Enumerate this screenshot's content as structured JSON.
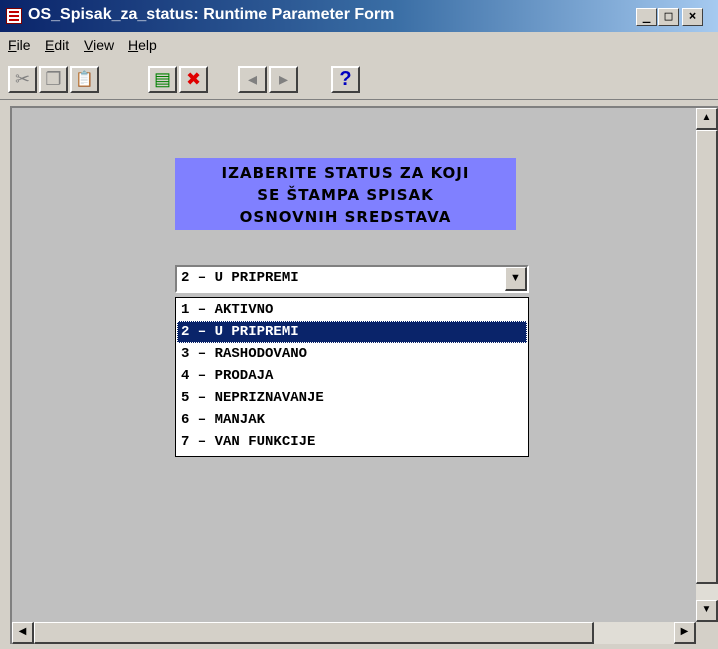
{
  "window": {
    "title": "OS_Spisak_za_status: Runtime Parameter Form",
    "controls": {
      "minimize": "_",
      "maximize": "□",
      "close": "×"
    }
  },
  "menu": {
    "items": [
      "File",
      "Edit",
      "View",
      "Help"
    ]
  },
  "toolbar": {
    "buttons": [
      {
        "icon": "cut-icon",
        "glyph": "✂"
      },
      {
        "icon": "copy-icon",
        "glyph": "❐"
      },
      {
        "icon": "paste-icon",
        "glyph": "📋"
      },
      {
        "icon": "run-report-icon",
        "glyph": "▤"
      },
      {
        "icon": "cancel-icon",
        "glyph": "✖"
      },
      {
        "icon": "prev-page-icon",
        "glyph": "◂"
      },
      {
        "icon": "next-page-icon",
        "glyph": "▸"
      },
      {
        "icon": "help-icon",
        "glyph": "?"
      }
    ]
  },
  "form": {
    "prompt_lines": [
      "IZABERITE STATUS ZA KOJI",
      "SE ŠTAMPA SPISAK",
      "OSNOVNIH SREDSTAVA"
    ],
    "prompt_bg": "#8080ff",
    "combo_value": "2 – U PRIPREMI",
    "options": [
      "1 – AKTIVNO",
      "2 – U PRIPREMI",
      "3 – RASHODOVANO",
      "4 – PRODAJA",
      "5 – NEPRIZNAVANJE",
      "6 – MANJAK",
      "7 – VAN FUNKCIJE"
    ],
    "selected_index": 1,
    "selection_color": "#0a246a"
  }
}
